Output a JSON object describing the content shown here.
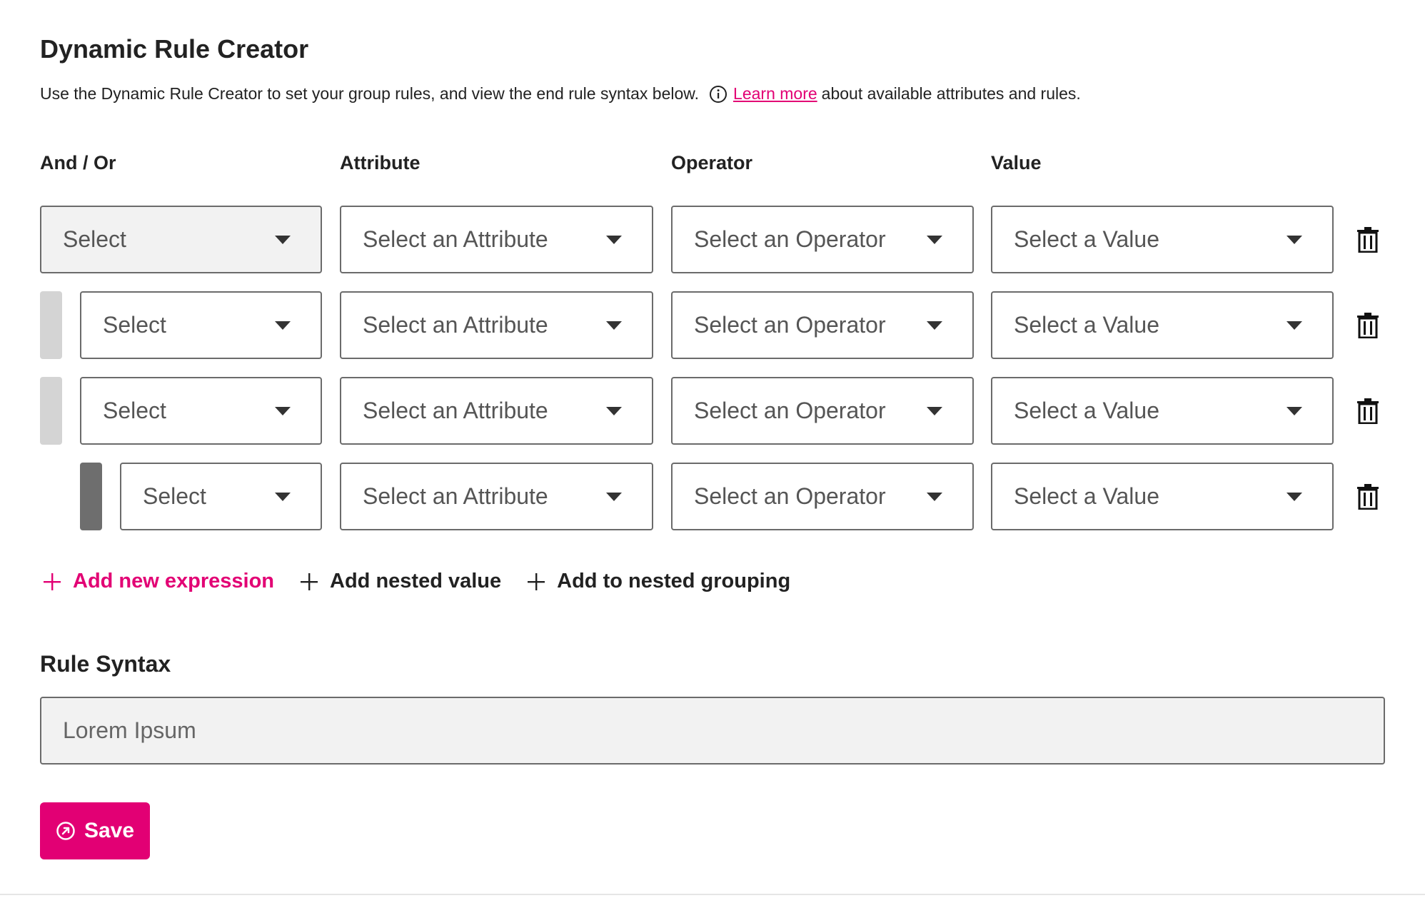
{
  "header": {
    "title": "Dynamic Rule Creator",
    "description_before": "Use the Dynamic Rule Creator to set your group rules, and view the end rule syntax below.",
    "learn_more_link": "Learn more",
    "description_after": "about available attributes and rules."
  },
  "columns": {
    "and_or": "And / Or",
    "attribute": "Attribute",
    "operator": "Operator",
    "value": "Value"
  },
  "rows": [
    {
      "and_or": "Select",
      "attribute": "Select an Attribute",
      "operator": "Select an Operator",
      "value": "Select a Value"
    },
    {
      "and_or": "Select",
      "attribute": "Select an Attribute",
      "operator": "Select an Operator",
      "value": "Select a Value"
    },
    {
      "and_or": "Select",
      "attribute": "Select an Attribute",
      "operator": "Select an Operator",
      "value": "Select a Value"
    },
    {
      "and_or": "Select",
      "attribute": "Select an Attribute",
      "operator": "Select an Operator",
      "value": "Select a Value"
    }
  ],
  "actions": {
    "add_new_expression": "Add new expression",
    "add_nested_value": "Add nested value",
    "add_to_nested_grouping": "Add to nested grouping"
  },
  "rule_syntax": {
    "label": "Rule Syntax",
    "value": "Lorem Ipsum"
  },
  "save_button": {
    "label": "Save"
  },
  "colors": {
    "accent": "#e20074",
    "border": "#6b6b6b",
    "disabled_bg": "#f2f2f2",
    "nest_bar_light": "#d4d4d4",
    "nest_bar_dark": "#6e6e6e"
  },
  "icons": {
    "info": "info-icon",
    "caret": "caret-down-icon",
    "delete": "trash-icon",
    "add": "plus-icon",
    "save": "arrow-circle-icon"
  }
}
